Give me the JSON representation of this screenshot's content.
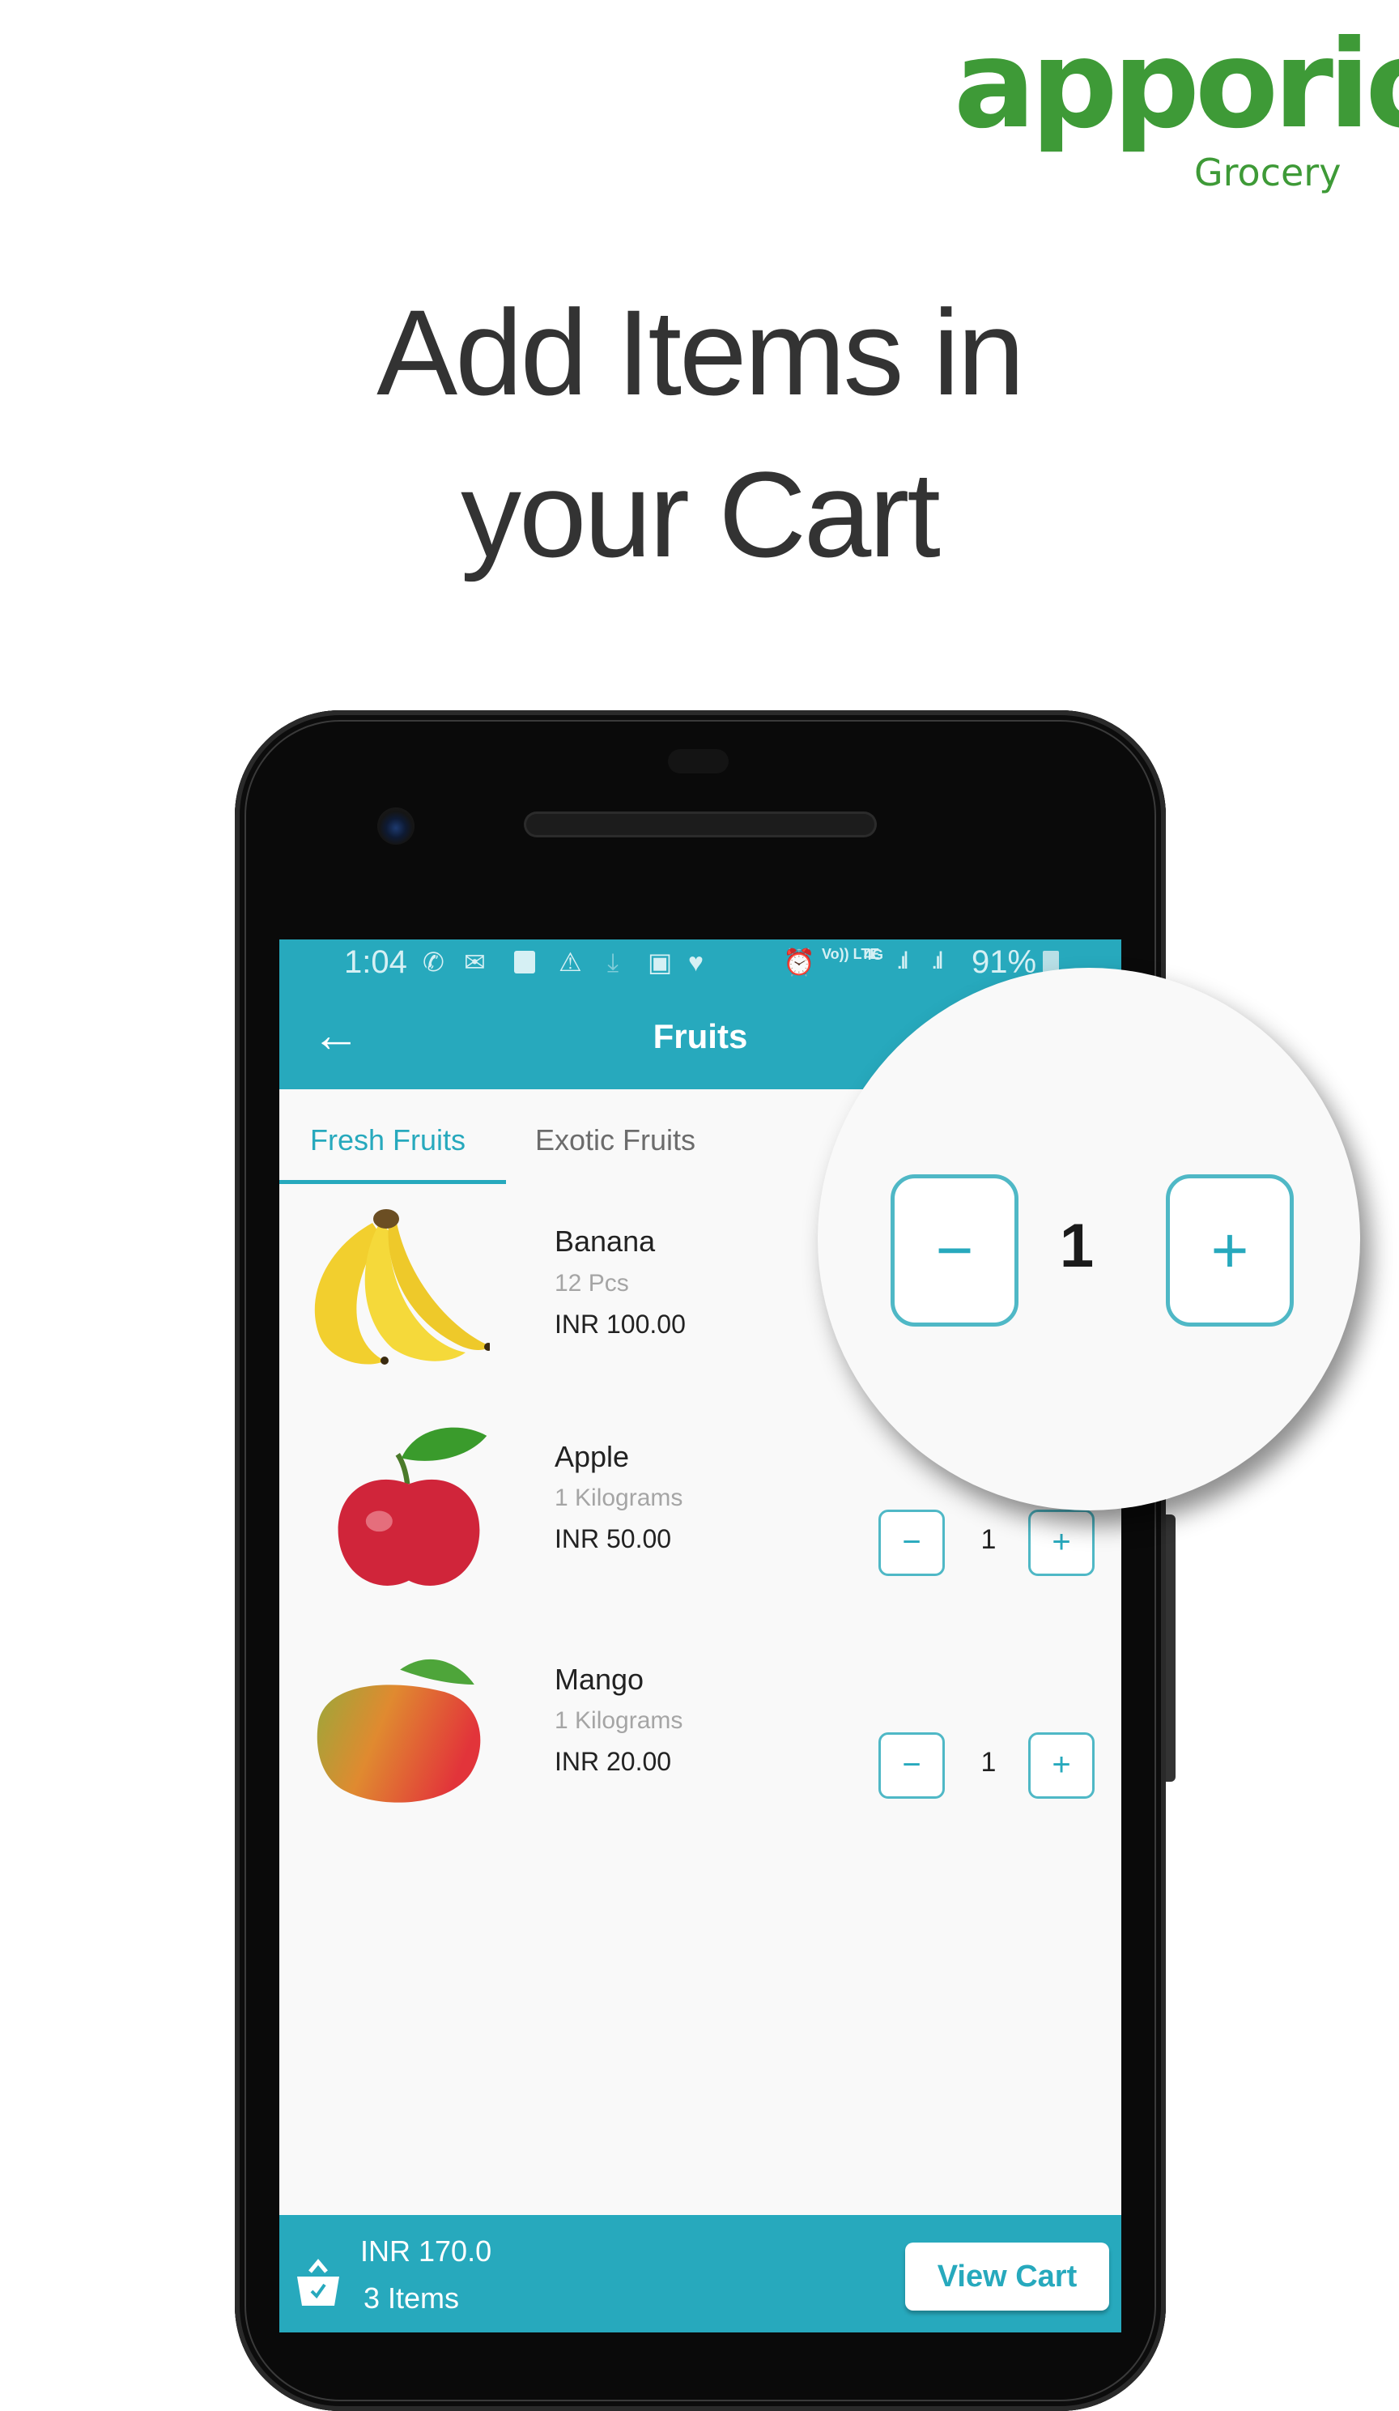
{
  "brand": {
    "name": "apporio",
    "subtitle": "Grocery",
    "color": "#3e9a37"
  },
  "headline": {
    "line1": "Add Items in",
    "line2": "your Cart"
  },
  "status_bar": {
    "time": "1:04",
    "left_icons": [
      "whatsapp-icon",
      "gmail-icon",
      "screen-recorder-icon",
      "warning-icon",
      "download-icon",
      "gallery-icon",
      "health-icon"
    ],
    "right_icons": [
      "alarm-icon",
      "volte-icon",
      "4g-icon",
      "signal-icon",
      "signal-icon"
    ],
    "battery": "91%",
    "volte_label": "Vo)) LTE",
    "network_label": "4G"
  },
  "app_bar": {
    "title": "Fruits",
    "back_icon": "arrow-left-icon",
    "color": "#27a9bd"
  },
  "tabs": [
    {
      "label": "Fresh Fruits",
      "active": true
    },
    {
      "label": "Exotic Fruits",
      "active": false
    }
  ],
  "products": [
    {
      "name": "Banana",
      "unit": "12 Pcs",
      "price": "INR 100.00",
      "quantity": "1",
      "image": "banana"
    },
    {
      "name": "Apple",
      "unit": "1 Kilograms",
      "price": "INR 50.00",
      "quantity": "1",
      "image": "apple"
    },
    {
      "name": "Mango",
      "unit": "1 Kilograms",
      "price": "INR 20.00",
      "quantity": "1",
      "image": "mango"
    }
  ],
  "stepper": {
    "minus": "−",
    "plus": "+"
  },
  "magnifier": {
    "quantity": "1"
  },
  "cart_bar": {
    "total": "INR 170.0",
    "count": "3 Items",
    "button": "View Cart",
    "icon": "shopping-basket-icon"
  }
}
